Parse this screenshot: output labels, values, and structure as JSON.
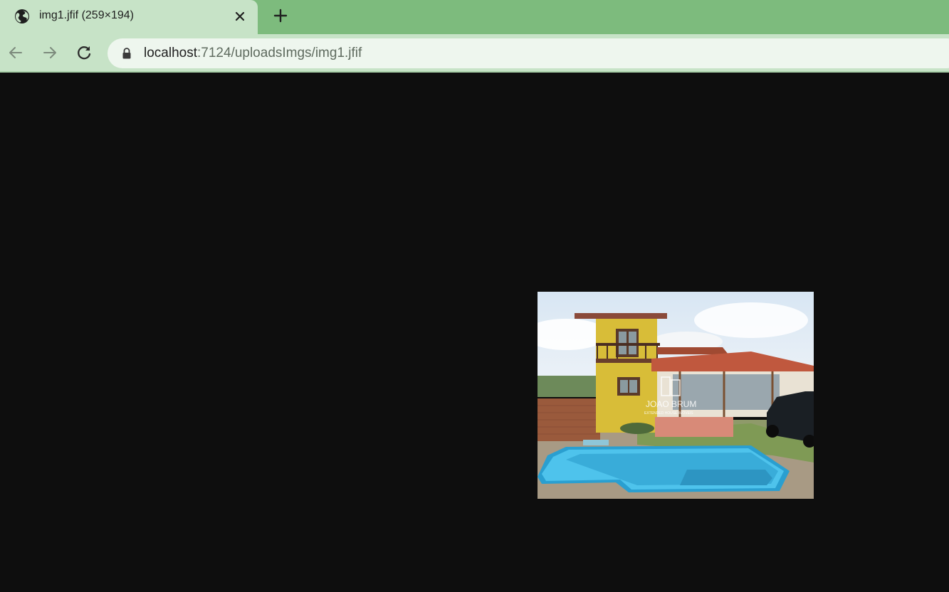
{
  "tab": {
    "title": "img1.jfif (259×194)",
    "favicon": "globe-icon",
    "close_icon": "close-icon"
  },
  "new_tab_icon": "plus-icon",
  "toolbar": {
    "back_icon": "arrow-left-icon",
    "forward_icon": "arrow-right-icon",
    "reload_icon": "reload-icon",
    "lock_icon": "lock-icon",
    "url_host": "localhost",
    "url_rest": ":7124/uploadsImgs/img1.jfif"
  },
  "image": {
    "watermark_line1": "JOAO BRUM",
    "watermark_line2": "EXTENDED HOUSE IMOVEIS"
  },
  "colors": {
    "tabstrip": "#7dbb7d",
    "active_tab": "#c7e3c7",
    "omnibox": "#eef6ee",
    "viewport": "#0e0e0e"
  }
}
